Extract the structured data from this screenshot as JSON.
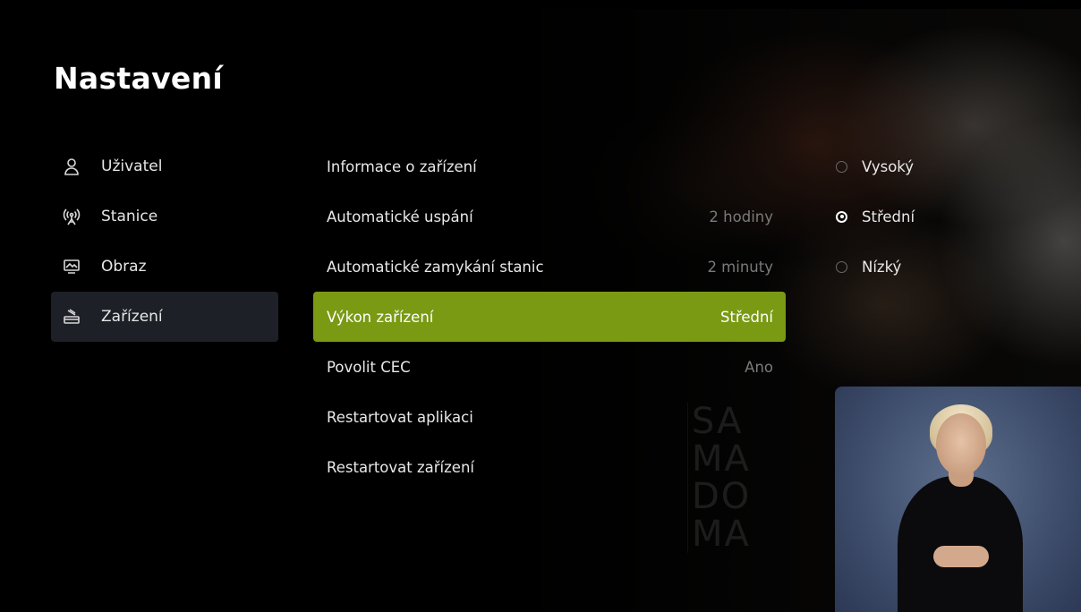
{
  "page": {
    "title": "Nastavení"
  },
  "sidebar": {
    "items": [
      {
        "label": "Uživatel",
        "icon": "user-icon",
        "active": false
      },
      {
        "label": "Stanice",
        "icon": "antenna-icon",
        "active": false
      },
      {
        "label": "Obraz",
        "icon": "screen-icon",
        "active": false
      },
      {
        "label": "Zařízení",
        "icon": "device-icon",
        "active": true
      }
    ]
  },
  "settings": {
    "rows": [
      {
        "label": "Informace o zařízení",
        "value": ""
      },
      {
        "label": "Automatické uspání",
        "value": "2 hodiny"
      },
      {
        "label": "Automatické zamykání stanic",
        "value": "2 minuty"
      },
      {
        "label": "Výkon zařízení",
        "value": "Střední",
        "active": true
      },
      {
        "label": "Povolit CEC",
        "value": "Ano"
      },
      {
        "label": "Restartovat aplikaci",
        "value": ""
      },
      {
        "label": "Restartovat zařízení",
        "value": ""
      }
    ]
  },
  "options": {
    "items": [
      {
        "label": "Vysoký",
        "checked": false
      },
      {
        "label": "Střední",
        "checked": true
      },
      {
        "label": "Nízký",
        "checked": false
      }
    ]
  },
  "background": {
    "watermark": [
      "SA",
      "MA",
      "DO",
      "MA"
    ]
  },
  "colors": {
    "accent": "#7a9a14",
    "sidebar_active": "#1d2026",
    "value_text": "#7a7a7a"
  }
}
